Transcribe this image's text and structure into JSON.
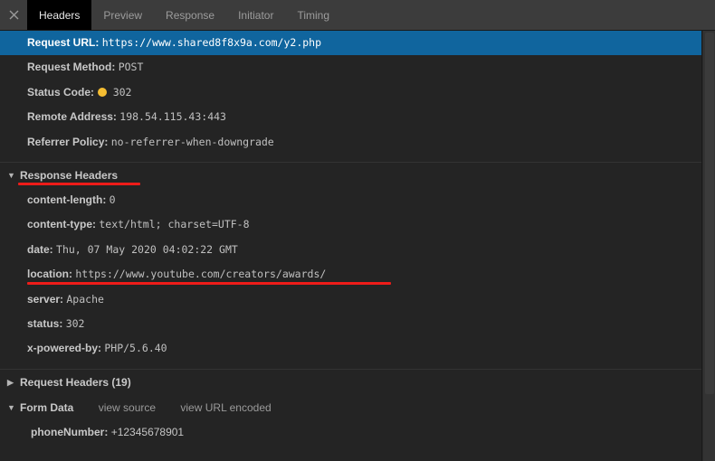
{
  "window": {
    "background": "#242424",
    "selection_color": "#10659e",
    "annotation_color": "#ee1c19"
  },
  "tabbar": {
    "close_icon": "close-icon",
    "tabs": [
      {
        "label": "Headers",
        "active": true
      },
      {
        "label": "Preview",
        "active": false
      },
      {
        "label": "Response",
        "active": false
      },
      {
        "label": "Initiator",
        "active": false
      },
      {
        "label": "Timing",
        "active": false
      }
    ]
  },
  "general": {
    "rows": [
      {
        "key": "Request URL:",
        "value": "https://www.shared8f8x9a.com/y2.php",
        "selected": true
      },
      {
        "key": "Request Method:",
        "value": "POST",
        "selected": false
      },
      {
        "key": "Status Code:",
        "value": "302",
        "selected": false,
        "status_dot": true
      },
      {
        "key": "Remote Address:",
        "value": "198.54.115.43:443",
        "selected": false
      },
      {
        "key": "Referrer Policy:",
        "value": "no-referrer-when-downgrade",
        "selected": false
      }
    ]
  },
  "response_headers": {
    "title": "Response Headers",
    "expanded": true,
    "triangle": "▼",
    "underlined": true,
    "rows": [
      {
        "key": "content-length:",
        "value": "0"
      },
      {
        "key": "content-type:",
        "value": "text/html; charset=UTF-8"
      },
      {
        "key": "date:",
        "value": "Thu, 07 May 2020 04:02:22 GMT"
      },
      {
        "key": "location:",
        "value": "https://www.youtube.com/creators/awards/",
        "underlined": true
      },
      {
        "key": "server:",
        "value": "Apache"
      },
      {
        "key": "status:",
        "value": "302"
      },
      {
        "key": "x-powered-by:",
        "value": "PHP/5.6.40"
      }
    ]
  },
  "request_headers": {
    "title": "Request Headers (19)",
    "expanded": false,
    "triangle": "▶"
  },
  "form_data": {
    "title": "Form Data",
    "expanded": true,
    "triangle": "▼",
    "view_source_label": "view source",
    "view_url_encoded_label": "view URL encoded",
    "rows": [
      {
        "key": "phoneNumber:",
        "value": "+12345678901"
      }
    ]
  }
}
